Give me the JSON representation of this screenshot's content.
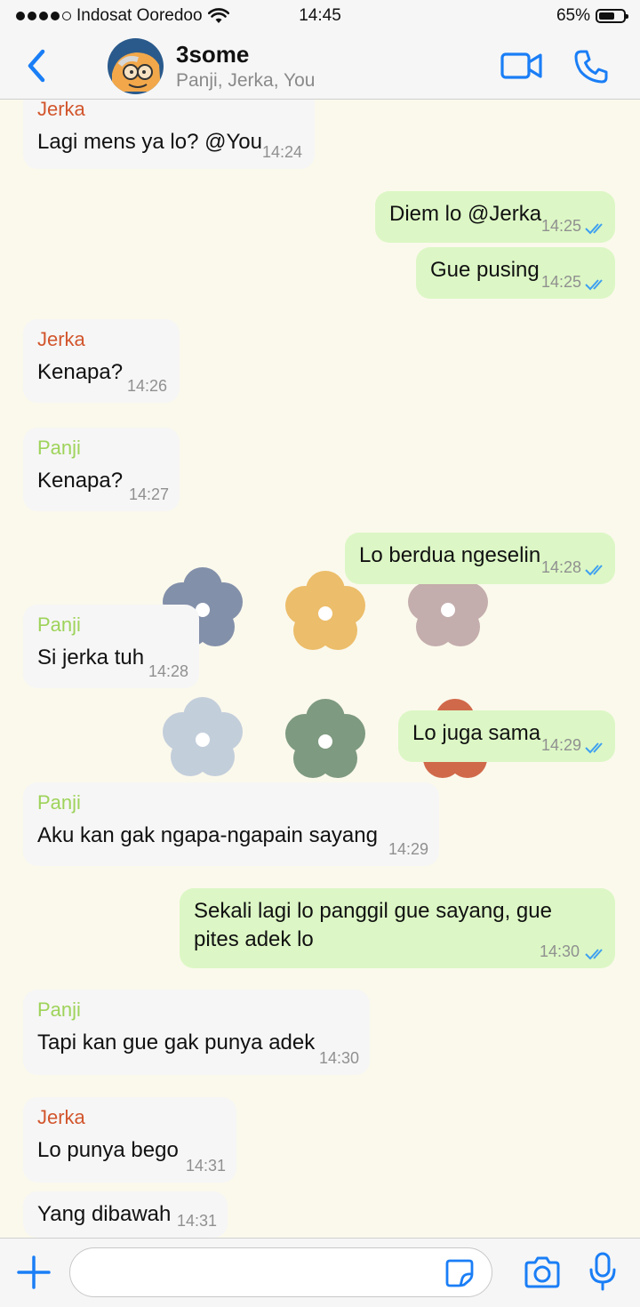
{
  "status": {
    "carrier": "Indosat Ooredoo",
    "time": "14:45",
    "battery": "65%",
    "battery_level": 0.65
  },
  "header": {
    "title": "3some",
    "members": "Panji, Jerka, You"
  },
  "colors": {
    "accent": "#1a7ef6",
    "outgoing_bubble": "#dcf7c5",
    "incoming_bubble": "#f6f6f6",
    "jerka": "#d2562d",
    "panji": "#9ed35a",
    "ticks": "#3fa0f0"
  },
  "messages": [
    {
      "sender": "Jerka",
      "text": "Lagi mens ya lo? @You",
      "time": "14:24"
    },
    {
      "text": "Diem lo @Jerka",
      "time": "14:25"
    },
    {
      "text": "Gue pusing",
      "time": "14:25"
    },
    {
      "sender": "Jerka",
      "text": "Kenapa?",
      "time": "14:26"
    },
    {
      "sender": "Panji",
      "text": "Kenapa?",
      "time": "14:27"
    },
    {
      "text": "Lo berdua ngeselin",
      "time": "14:28"
    },
    {
      "sender": "Panji",
      "text": "Si jerka tuh",
      "time": "14:28"
    },
    {
      "text": "Lo juga sama",
      "time": "14:29"
    },
    {
      "sender": "Panji",
      "text": "Aku kan gak ngapa-ngapain sayang",
      "time": "14:29"
    },
    {
      "text": "Sekali lagi lo panggil gue sayang, gue pites adek lo",
      "time": "14:30"
    },
    {
      "sender": "Panji",
      "text": "Tapi kan gue gak punya adek",
      "time": "14:30"
    },
    {
      "sender": "Jerka",
      "text": "Lo punya bego",
      "time": "14:31"
    },
    {
      "text": "Yang dibawah",
      "time": "14:31"
    }
  ]
}
